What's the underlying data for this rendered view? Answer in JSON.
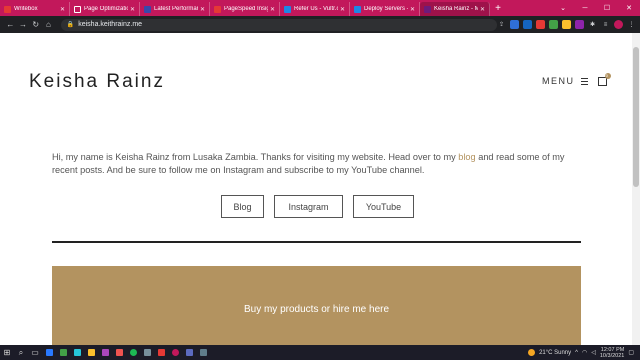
{
  "browser": {
    "tabs": [
      {
        "label": "Writebox",
        "color": "#e53935",
        "active": false
      },
      {
        "label": "Page Optimizatio",
        "color": "#c2185b",
        "active": false
      },
      {
        "label": "Latest Performan",
        "color": "#3949ab",
        "active": false
      },
      {
        "label": "PageSpeed Insigh",
        "color": "#e53935",
        "active": false
      },
      {
        "label": "Refer Us - Vultr.c",
        "color": "#1e88e5",
        "active": false
      },
      {
        "label": "Deploy Servers -",
        "color": "#1e88e5",
        "active": false
      },
      {
        "label": "Keisha Rainz - M",
        "color": "#6d1b7b",
        "active": true
      }
    ],
    "new_tab": "+",
    "url": "keisha.keithrainz.me"
  },
  "site": {
    "title": "Keisha Rainz",
    "menu_label": "MENU",
    "cart_count": "0"
  },
  "intro": {
    "before_link": "Hi, my name is Keisha Rainz from Lusaka Zambia. Thanks for visiting my website. Head over to my ",
    "link_text": "blog",
    "after_link": " and read some of my recent posts. And be sure to follow me on Instagram and subscribe to my YouTube channel."
  },
  "buttons": {
    "blog": "Blog",
    "instagram": "Instagram",
    "youtube": "YouTube"
  },
  "cta": {
    "text": "Buy my products or hire me here"
  },
  "taskbar": {
    "weather": "21°C  Sunny",
    "time": "12:07 PM",
    "date": "10/3/2021"
  },
  "colors": {
    "accent": "#b39360",
    "tabstrip": "#c2185b"
  }
}
